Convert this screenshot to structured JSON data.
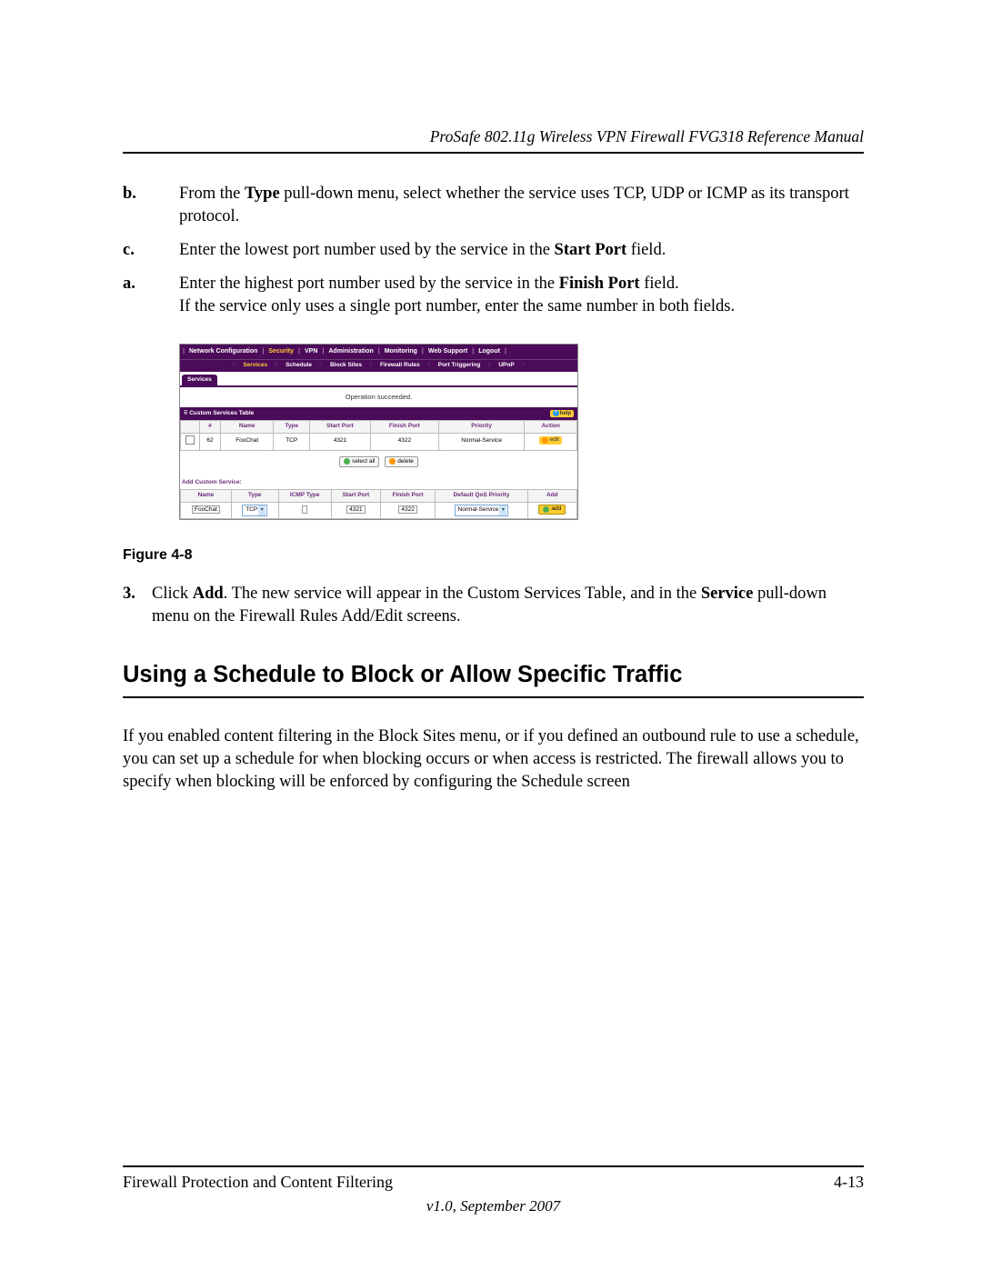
{
  "header": {
    "title": "ProSafe 802.11g Wireless VPN Firewall FVG318 Reference Manual"
  },
  "steps": {
    "b_label": "b.",
    "b_pre": "From the ",
    "b_bold": "Type",
    "b_post": " pull-down menu, select whether the service uses TCP, UDP or ICMP as its transport protocol.",
    "c_label": "c.",
    "c_pre": "Enter the lowest port number used by the service in the ",
    "c_bold": "Start Port",
    "c_post": " field.",
    "a_label": "a.",
    "a_pre": "Enter the highest port number used by the service in the ",
    "a_bold": "Finish Port",
    "a_post": " field.",
    "a_line2": "If the service only uses a single port number, enter the same number in both fields."
  },
  "shot": {
    "menu1": [
      "Network Configuration",
      "Security",
      "VPN",
      "Administration",
      "Monitoring",
      "Web Support",
      "Logout"
    ],
    "menu1_active_index": 1,
    "menu2": [
      "Services",
      "Schedule",
      "Block Sites",
      "Firewall Rules",
      "Port Triggering",
      "UPnP"
    ],
    "menu2_active_index": 0,
    "tab": "Services",
    "status": "Operation succeeded.",
    "section_title": "Custom Services Table",
    "help_label": "help",
    "table_headers": [
      "",
      "#",
      "Name",
      "Type",
      "Start Port",
      "Finish Port",
      "Priority",
      "Action"
    ],
    "table_row": {
      "num": "62",
      "name": "FooChat",
      "type": "TCP",
      "start": "4321",
      "finish": "4322",
      "priority": "Normal-Service",
      "action_label": "edit"
    },
    "btn_selectall": "select all",
    "btn_delete": "delete",
    "add_section": "Add Custom Service:",
    "add_headers": [
      "Name",
      "Type",
      "ICMP Type",
      "Start Port",
      "Finish Port",
      "Default QoS Priority",
      "Add"
    ],
    "add_row": {
      "name": "FooChat",
      "type": "TCP",
      "icmp": "",
      "start": "4321",
      "finish": "4322",
      "qos": "Normal-Service",
      "add_label": "add"
    }
  },
  "figure_caption": "Figure 4-8",
  "step3": {
    "num": "3.",
    "pre": "Click ",
    "bold1": "Add",
    "mid": ". The new service will appear in the Custom Services Table, and in the ",
    "bold2": "Service",
    "post": " pull-down menu on the Firewall Rules Add/Edit screens."
  },
  "heading": "Using a Schedule to Block or Allow Specific Traffic",
  "para": "If you enabled content filtering in the Block Sites menu, or if you defined an outbound rule to use a schedule, you can set up a schedule for when blocking occurs or when access is restricted. The firewall allows you to specify when blocking will be enforced by configuring the Schedule screen",
  "footer": {
    "left": "Firewall Protection and Content Filtering",
    "right": "4-13",
    "version": "v1.0, September 2007"
  }
}
